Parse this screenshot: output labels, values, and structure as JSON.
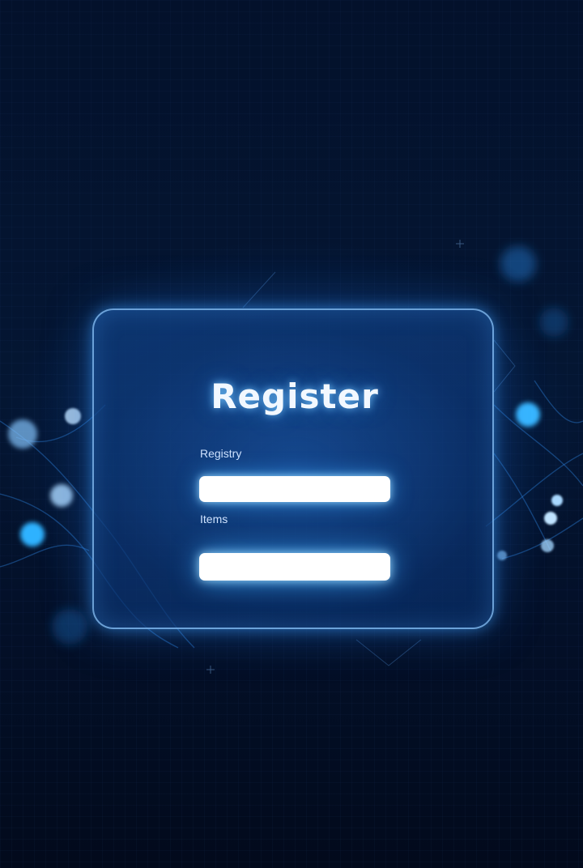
{
  "form": {
    "title": "Register",
    "field_1_label": "Registry",
    "field_1_value": "",
    "field_2_label": "Items",
    "field_2_value": ""
  },
  "colors": {
    "background": "#020b1f",
    "accent": "#3aa8ff",
    "card_border": "#8cc8ff",
    "field_fill": "#ffffff"
  }
}
